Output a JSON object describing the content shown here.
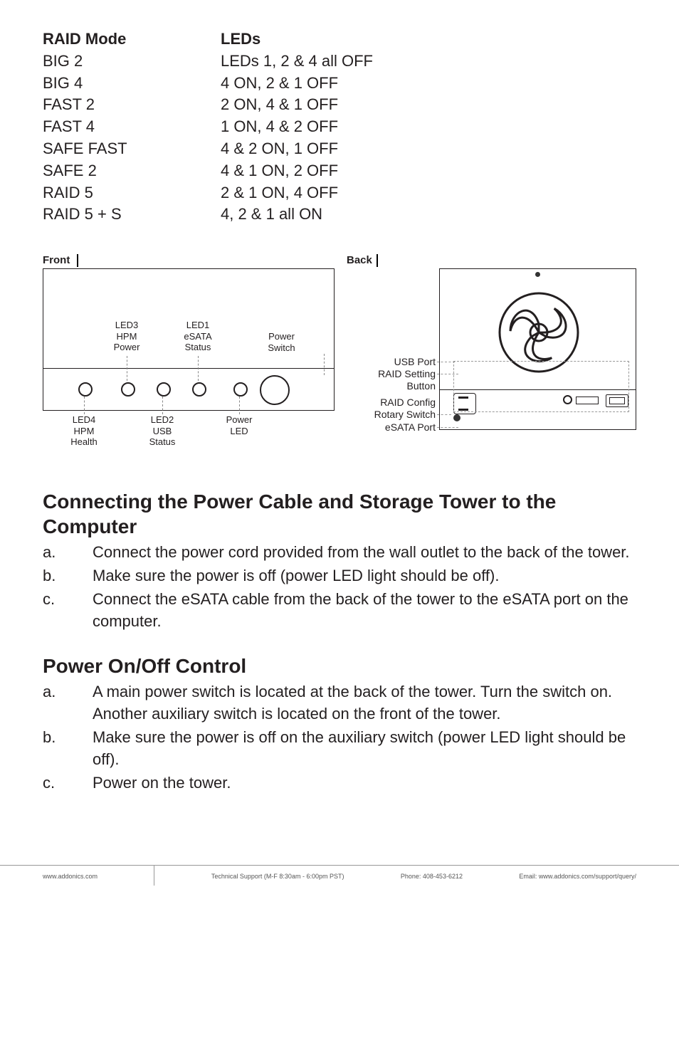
{
  "raid_table": {
    "mode_header": "RAID Mode",
    "led_header": "LEDs",
    "rows": [
      {
        "mode": "BIG 2",
        "led": "LEDs 1, 2 & 4 all OFF"
      },
      {
        "mode": "BIG 4",
        "led": "4 ON, 2 & 1 OFF"
      },
      {
        "mode": "FAST 2",
        "led": "2 ON, 4 & 1 OFF"
      },
      {
        "mode": "FAST 4",
        "led": "1 ON, 4 & 2 OFF"
      },
      {
        "mode": "SAFE FAST",
        "led": "4 & 2 ON, 1 OFF"
      },
      {
        "mode": "SAFE 2",
        "led": "4 & 1 ON, 2 OFF"
      },
      {
        "mode": "RAID 5",
        "led": "2 & 1 ON, 4 OFF"
      },
      {
        "mode": "RAID 5 + S",
        "led": "4, 2 & 1 all ON"
      }
    ]
  },
  "front": {
    "title": "Front",
    "led3": "LED3\nHPM\nPower",
    "led1": "LED1\neSATA\nStatus",
    "power_switch": "Power\nSwitch",
    "led4": "LED4\nHPM\nHealth",
    "led2": "LED2\nUSB\nStatus",
    "power_led": "Power\nLED"
  },
  "back": {
    "title": "Back",
    "usb_port": "USB Port",
    "raid_setting": "RAID Setting\nButton",
    "raid_config": "RAID Config\nRotary Switch",
    "esata_port": "eSATA Port"
  },
  "sections": {
    "connect_title": "Connecting the Power Cable and Storage Tower to the Computer",
    "connect_steps": [
      "Connect the power cord provided from the wall outlet to the back of the tower.",
      "Make sure the power is off (power LED light should be off).",
      "Connect the eSATA cable from the back of the tower to the eSATA port on the computer."
    ],
    "power_title": "Power On/Off Control",
    "power_steps": [
      "A main power switch is located at the back of the tower. Turn the switch on. Another auxiliary switch is located on the front of the tower.",
      "Make sure the power is off on the auxiliary switch (power LED light should be off).",
      "Power on the tower."
    ]
  },
  "footer": {
    "url": "www.addonics.com",
    "support": "Technical Support (M-F 8:30am - 6:00pm PST)",
    "phone": "Phone: 408-453-6212",
    "email": "Email: www.addonics.com/support/query/"
  },
  "letters": [
    "a.",
    "b.",
    "c."
  ]
}
